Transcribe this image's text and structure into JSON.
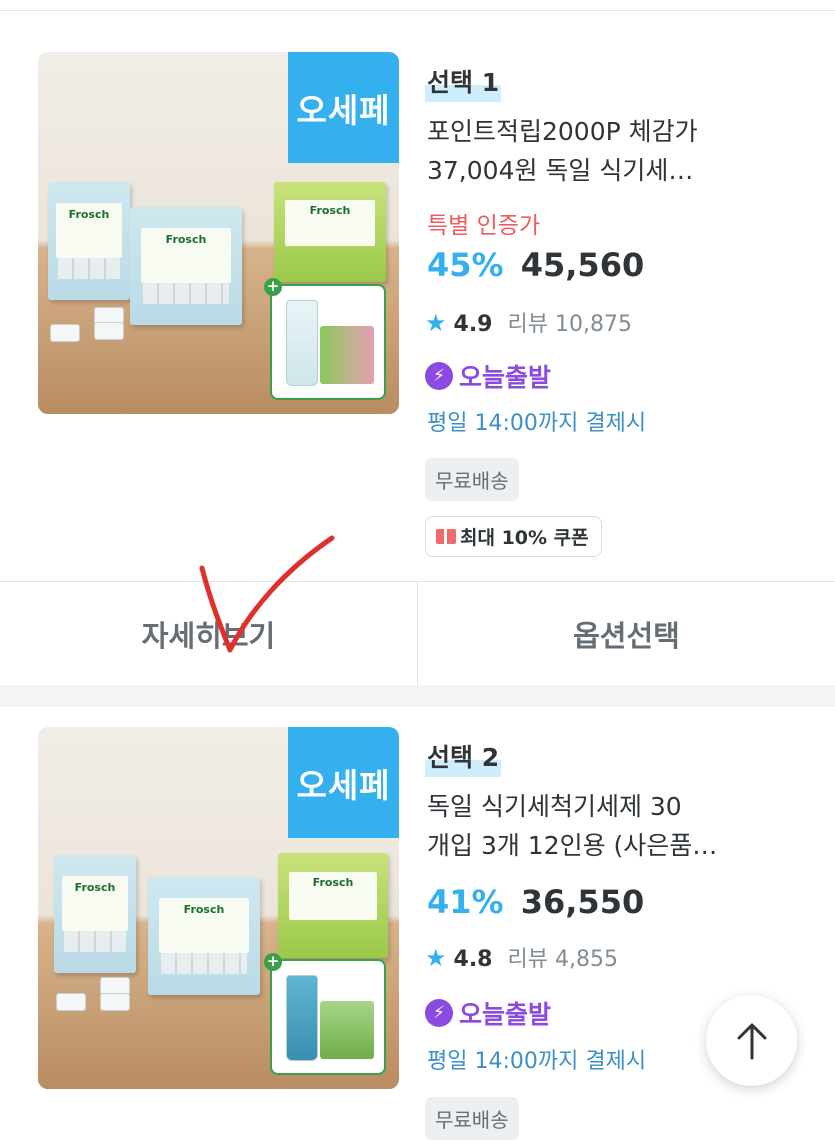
{
  "products": [
    {
      "badge": "오세페",
      "option_label": "선택 1",
      "title_line1": "포인트적립2000P 체감가",
      "title_line2": "37,004원 독일 식기세…",
      "special_label": "특별 인증가",
      "discount": "45%",
      "price": "45,560",
      "rating": "4.9",
      "review_label": "리뷰",
      "review_count": "10,875",
      "today_ship": "오늘출발",
      "deadline": "평일 14:00까지 결제시",
      "free_shipping": "무료배송",
      "coupon": "최대 10% 쿠폰",
      "box_left_label": "Frosch",
      "box_mid_label": "Frosch",
      "box_right_label": "Frosch"
    },
    {
      "badge": "오세페",
      "option_label": "선택 2",
      "title_line1": "독일 식기세척기세제 30",
      "title_line2": "개입 3개 12인용 (사은품…",
      "discount": "41%",
      "price": "36,550",
      "rating": "4.8",
      "review_label": "리뷰",
      "review_count": "4,855",
      "today_ship": "오늘출발",
      "deadline": "평일 14:00까지 결제시",
      "free_shipping": "무료배송",
      "box_left_label": "Frosch",
      "box_mid_label": "Frosch",
      "box_right_label": "Frosch"
    }
  ],
  "actions": {
    "detail": "자세히보기",
    "option": "옵션선택"
  },
  "icons": {
    "star": "star-icon",
    "bolt": "lightning-icon",
    "coupon": "coupon-icon",
    "scroll_top": "arrow-up-icon"
  },
  "colors": {
    "accent_blue": "#35b0ef",
    "special_red": "#f05b5b",
    "today_purple": "#8c4be0",
    "deadline_blue": "#3d8fc7",
    "annotation_red": "#e0302a"
  }
}
